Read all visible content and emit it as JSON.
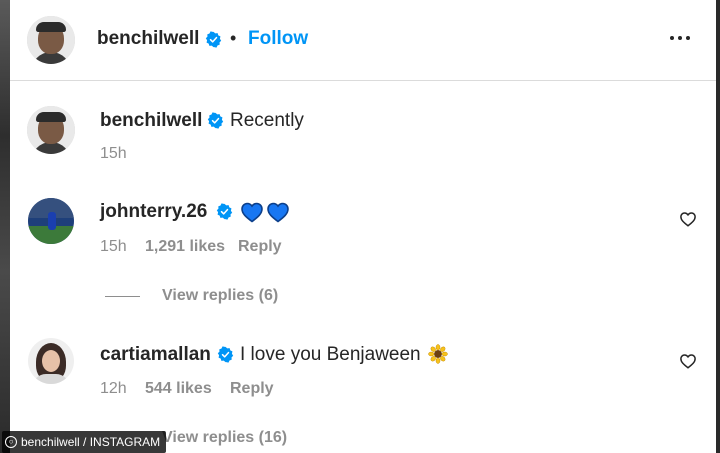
{
  "post_header": {
    "username": "benchilwell",
    "separator": "•",
    "follow_label": "Follow"
  },
  "caption": {
    "username": "benchilwell",
    "text": "Recently",
    "time": "15h"
  },
  "comments": [
    {
      "username": "johnterry.26",
      "text": "",
      "emoji": "blue-heart-icon x2",
      "time": "15h",
      "likes": "1,291 likes",
      "reply_label": "Reply",
      "view_replies": "View replies (6)"
    },
    {
      "username": "cartiamallan",
      "text": "I love you Benjaween",
      "emoji": "sunflower-icon",
      "time": "12h",
      "likes": "544 likes",
      "reply_label": "Reply",
      "view_replies": "View replies (16)"
    }
  ],
  "credit": {
    "text": "benchilwell / INSTAGRAM"
  },
  "colors": {
    "accent": "#0095f6",
    "verified": "#0095f6",
    "heart_blue": "#1877f2",
    "muted": "#8e8e8e"
  }
}
